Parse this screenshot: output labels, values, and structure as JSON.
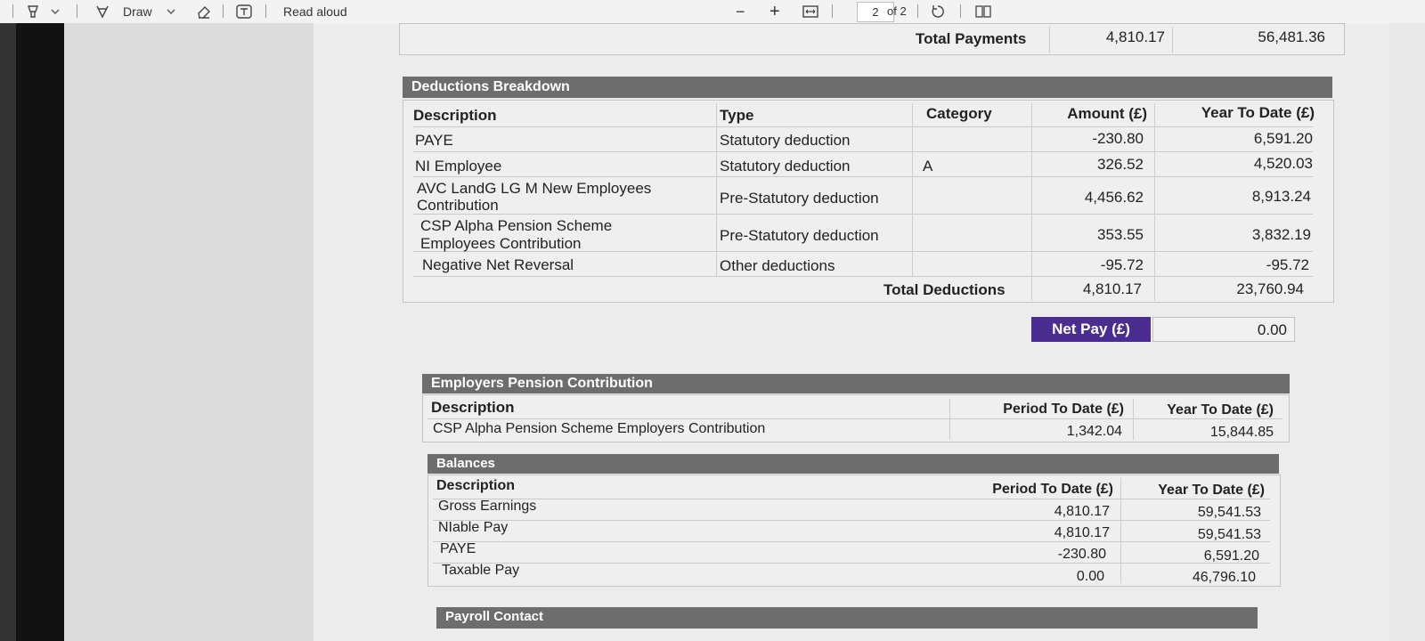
{
  "toolbar": {
    "draw_label": "Draw",
    "read_aloud_label": "Read aloud",
    "zoom_out": "−",
    "zoom_in": "+",
    "page_current": "2",
    "page_total": "of 2",
    "icons": [
      "highlighter-icon",
      "chevron-down-icon",
      "draw-icon",
      "eraser-icon",
      "text-box-icon",
      "fit-page-icon",
      "rotate-icon",
      "two-page-icon"
    ]
  },
  "payments": {
    "total_label": "Total Payments",
    "total_amount": "4,810.17",
    "total_ytd": "56,481.36"
  },
  "deductions": {
    "title": "Deductions Breakdown",
    "headers": [
      "Description",
      "Type",
      "Category",
      "Amount (£)",
      "Year To Date (£)"
    ],
    "rows": [
      {
        "description": "PAYE",
        "type": "Statutory deduction",
        "category": "",
        "amount": "-230.80",
        "ytd": "6,591.20"
      },
      {
        "description": "NI Employee",
        "type": "Statutory deduction",
        "category": "A",
        "amount": "326.52",
        "ytd": "4,520.03"
      },
      {
        "description": "AVC LandG LG M New Employees\nContribution",
        "type": "Pre-Statutory deduction",
        "category": "",
        "amount": "4,456.62",
        "ytd": "8,913.24"
      },
      {
        "description": "CSP Alpha Pension Scheme\nEmployees Contribution",
        "type": "Pre-Statutory deduction",
        "category": "",
        "amount": "353.55",
        "ytd": "3,832.19"
      },
      {
        "description": "Negative Net Reversal",
        "type": "Other deductions",
        "category": "",
        "amount": "-95.72",
        "ytd": "-95.72"
      }
    ],
    "total_label": "Total Deductions",
    "total_amount": "4,810.17",
    "total_ytd": "23,760.94"
  },
  "net_pay": {
    "label": "Net Pay (£)",
    "value": "0.00",
    "color": "#4a2d8f"
  },
  "employer_pension": {
    "title": "Employers Pension Contribution",
    "headers": [
      "Description",
      "Period To Date (£)",
      "Year To Date (£)"
    ],
    "rows": [
      {
        "description": "CSP Alpha Pension Scheme Employers Contribution",
        "period": "1,342.04",
        "ytd": "15,844.85"
      }
    ]
  },
  "balances": {
    "title": "Balances",
    "headers": [
      "Description",
      "Period To Date (£)",
      "Year To Date (£)"
    ],
    "rows": [
      {
        "description": "Gross Earnings",
        "period": "4,810.17",
        "ytd": "59,541.53"
      },
      {
        "description": "NIable Pay",
        "period": "4,810.17",
        "ytd": "59,541.53"
      },
      {
        "description": "PAYE",
        "period": "-230.80",
        "ytd": "6,591.20"
      },
      {
        "description": "Taxable Pay",
        "period": "0.00",
        "ytd": "46,796.10"
      }
    ]
  },
  "payroll_contact": {
    "title": "Payroll Contact"
  }
}
